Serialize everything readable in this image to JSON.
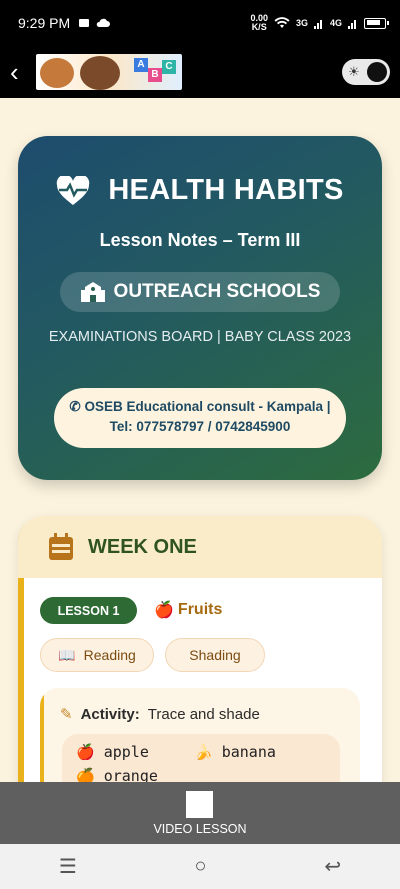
{
  "status": {
    "time": "9:29 PM",
    "speed": "0.00\nK/S",
    "net1": "3G",
    "net2": "4G"
  },
  "appbar": {
    "back_glyph": "‹",
    "logo_letters": [
      "A",
      "B",
      "C"
    ]
  },
  "hero": {
    "title": "HEALTH HABITS",
    "subtitle": "Lesson Notes – Term III",
    "pill": "OUTREACH SCHOOLS",
    "board": "EXAMINATIONS BOARD | BABY CLASS 2023",
    "contact": "OSEB Educational consult - Kampala | Tel: 077578797 / 0742845900"
  },
  "week": {
    "title": "WEEK ONE",
    "lesson_badge": "LESSON 1",
    "lesson_topic": "Fruits",
    "tags": [
      "Reading",
      "Shading"
    ],
    "activity_label": "Activity:",
    "activity_text": "Trace and shade",
    "fruits": [
      {
        "emoji": "🍎",
        "name": "apple"
      },
      {
        "emoji": "🍌",
        "name": "banana"
      },
      {
        "emoji": "🍊",
        "name": "orange"
      }
    ]
  },
  "video": {
    "label": "VIDEO LESSON"
  },
  "colors": {
    "accent_green": "#2e6a33",
    "accent_gold": "#e9b21b",
    "hero_blue": "#1d4c6e"
  }
}
